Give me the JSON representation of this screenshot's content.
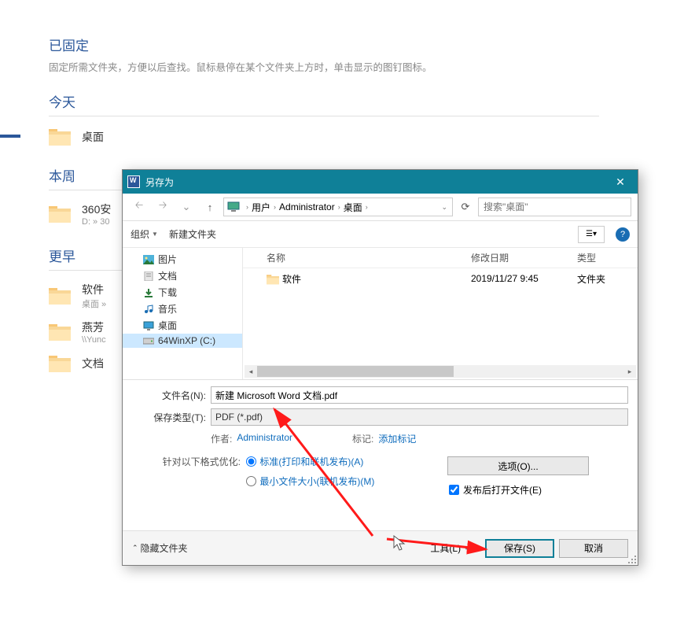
{
  "pinned": {
    "title": "已固定",
    "desc": "固定所需文件夹，方便以后查找。鼠标悬停在某个文件夹上方时，单击显示的图钉图标。"
  },
  "groups": {
    "today": {
      "title": "今天",
      "items": [
        {
          "name": "桌面",
          "sub": ""
        }
      ]
    },
    "week": {
      "title": "本周",
      "items": [
        {
          "name": "360安",
          "sub": "D: » 30"
        }
      ]
    },
    "earlier": {
      "title": "更早",
      "items": [
        {
          "name": "软件",
          "sub": "桌面 »"
        },
        {
          "name": "燕芳",
          "sub": "\\\\Yunc"
        },
        {
          "name": "文档",
          "sub": ""
        }
      ]
    }
  },
  "dialog": {
    "title": "另存为",
    "breadcrumb": {
      "parts": [
        "用户",
        "Administrator",
        "桌面"
      ]
    },
    "search_placeholder": "搜索\"桌面\"",
    "toolbar": {
      "organize": "组织",
      "newfolder": "新建文件夹"
    },
    "tree": [
      {
        "label": "图片",
        "icon": "pictures"
      },
      {
        "label": "文档",
        "icon": "documents"
      },
      {
        "label": "下载",
        "icon": "downloads"
      },
      {
        "label": "音乐",
        "icon": "music"
      },
      {
        "label": "桌面",
        "icon": "desktop"
      },
      {
        "label": "64WinXP  (C:)",
        "icon": "drive",
        "selected": true
      }
    ],
    "columns": {
      "name": "名称",
      "date": "修改日期",
      "type": "类型"
    },
    "rows": [
      {
        "name": "软件",
        "date": "2019/11/27 9:45",
        "type": "文件夹"
      }
    ],
    "filename_label": "文件名(N):",
    "filename_value": "新建 Microsoft Word 文档.pdf",
    "filetype_label": "保存类型(T):",
    "filetype_value": "PDF (*.pdf)",
    "author_label": "作者:",
    "author_value": "Administrator",
    "tags_label": "标记:",
    "tags_value": "添加标记",
    "optimize_label": "针对以下格式优化:",
    "opt_standard": "标准(打印和联机发布)(A)",
    "opt_min": "最小文件大小(联机发布)(M)",
    "options_btn": "选项(O)...",
    "open_after": "发布后打开文件(E)",
    "hide_folders": "隐藏文件夹",
    "tools": "工具(L)",
    "save": "保存(S)",
    "cancel": "取消"
  }
}
